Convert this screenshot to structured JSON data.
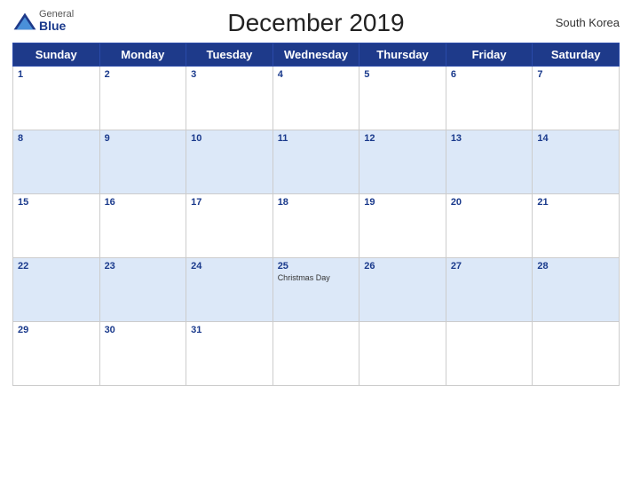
{
  "header": {
    "logo_general": "General",
    "logo_blue": "Blue",
    "title": "December 2019",
    "country": "South Korea"
  },
  "days": [
    "Sunday",
    "Monday",
    "Tuesday",
    "Wednesday",
    "Thursday",
    "Friday",
    "Saturday"
  ],
  "weeks": [
    {
      "blue": false,
      "cells": [
        {
          "date": "1",
          "holiday": ""
        },
        {
          "date": "2",
          "holiday": ""
        },
        {
          "date": "3",
          "holiday": ""
        },
        {
          "date": "4",
          "holiday": ""
        },
        {
          "date": "5",
          "holiday": ""
        },
        {
          "date": "6",
          "holiday": ""
        },
        {
          "date": "7",
          "holiday": ""
        }
      ]
    },
    {
      "blue": true,
      "cells": [
        {
          "date": "8",
          "holiday": ""
        },
        {
          "date": "9",
          "holiday": ""
        },
        {
          "date": "10",
          "holiday": ""
        },
        {
          "date": "11",
          "holiday": ""
        },
        {
          "date": "12",
          "holiday": ""
        },
        {
          "date": "13",
          "holiday": ""
        },
        {
          "date": "14",
          "holiday": ""
        }
      ]
    },
    {
      "blue": false,
      "cells": [
        {
          "date": "15",
          "holiday": ""
        },
        {
          "date": "16",
          "holiday": ""
        },
        {
          "date": "17",
          "holiday": ""
        },
        {
          "date": "18",
          "holiday": ""
        },
        {
          "date": "19",
          "holiday": ""
        },
        {
          "date": "20",
          "holiday": ""
        },
        {
          "date": "21",
          "holiday": ""
        }
      ]
    },
    {
      "blue": true,
      "cells": [
        {
          "date": "22",
          "holiday": ""
        },
        {
          "date": "23",
          "holiday": ""
        },
        {
          "date": "24",
          "holiday": ""
        },
        {
          "date": "25",
          "holiday": "Christmas Day"
        },
        {
          "date": "26",
          "holiday": ""
        },
        {
          "date": "27",
          "holiday": ""
        },
        {
          "date": "28",
          "holiday": ""
        }
      ]
    },
    {
      "blue": false,
      "cells": [
        {
          "date": "29",
          "holiday": ""
        },
        {
          "date": "30",
          "holiday": ""
        },
        {
          "date": "31",
          "holiday": ""
        },
        {
          "date": "",
          "holiday": ""
        },
        {
          "date": "",
          "holiday": ""
        },
        {
          "date": "",
          "holiday": ""
        },
        {
          "date": "",
          "holiday": ""
        }
      ]
    }
  ]
}
